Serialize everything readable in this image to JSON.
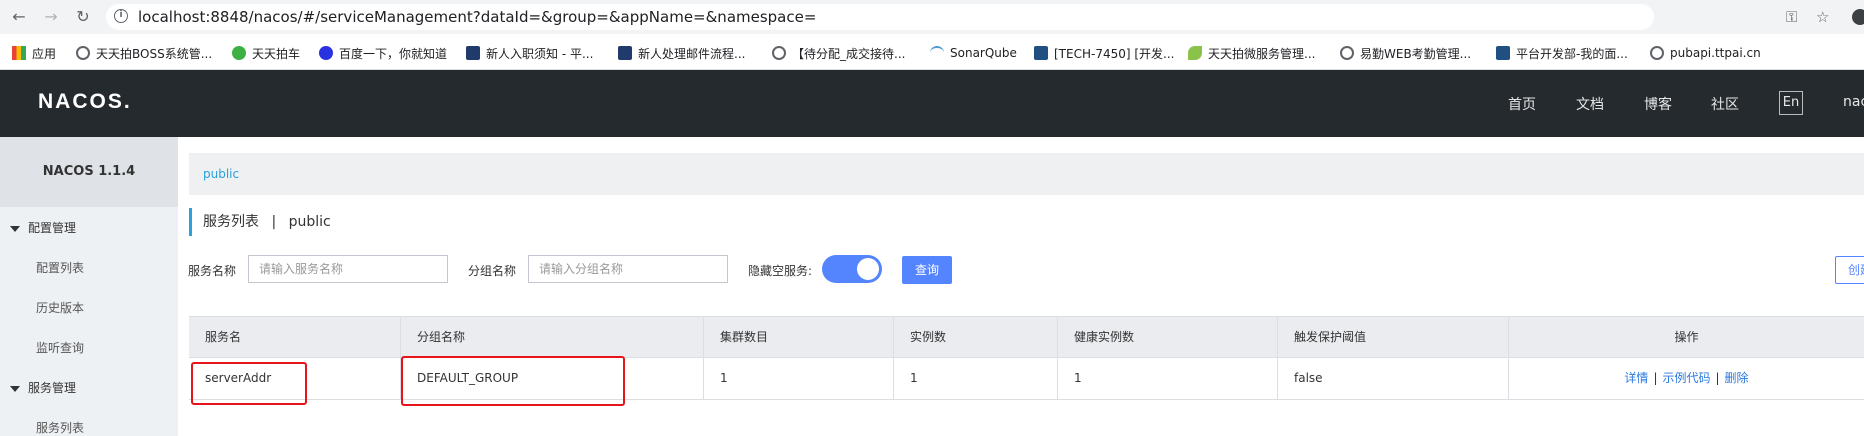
{
  "browser": {
    "url": "localhost:8848/nacos/#/serviceManagement?dataId=&group=&appName=&namespace=",
    "bookmarks": [
      "应用",
      "天天拍BOSS系统管...",
      "天天拍车",
      "百度一下，你就知道",
      "新人入职须知 - 平...",
      "新人处理邮件流程...",
      "【待分配_成交接待...",
      "SonarQube",
      "[TECH-7450] [开发...",
      "天天拍微服务管理...",
      "易勤WEB考勤管理...",
      "平台开发部-我的面...",
      "pubapi.ttpai.cn"
    ]
  },
  "header": {
    "logo": "NACOS.",
    "nav": [
      "首页",
      "文档",
      "博客",
      "社区"
    ],
    "lang": "En",
    "user": "nac"
  },
  "sidebar": {
    "version": "NACOS 1.1.4",
    "groups": [
      {
        "label": "配置管理",
        "items": [
          "配置列表",
          "历史版本",
          "监听查询"
        ]
      },
      {
        "label": "服务管理",
        "items": [
          "服务列表"
        ]
      }
    ]
  },
  "main": {
    "namespace_tab": "public",
    "title": "服务列表",
    "title_sep": "|",
    "title_ns": "public",
    "filters": {
      "service_label": "服务名称",
      "service_placeholder": "请输入服务名称",
      "group_label": "分组名称",
      "group_placeholder": "请输入分组名称",
      "hide_empty_label": "隐藏空服务:",
      "hide_empty_on": true,
      "query_button": "查询",
      "create_button": "创建"
    },
    "table": {
      "headers": [
        "服务名",
        "分组名称",
        "集群数目",
        "实例数",
        "健康实例数",
        "触发保护阈值",
        "操作"
      ],
      "rows": [
        {
          "name": "serverAddr",
          "group": "DEFAULT_GROUP",
          "clusters": "1",
          "instances": "1",
          "healthy": "1",
          "threshold": "false",
          "ops": [
            "详情",
            "示例代码",
            "删除"
          ]
        }
      ]
    }
  },
  "colors": {
    "accent": "#5584ff",
    "header_bg": "#252a2f",
    "highlight": "#e8141b"
  }
}
